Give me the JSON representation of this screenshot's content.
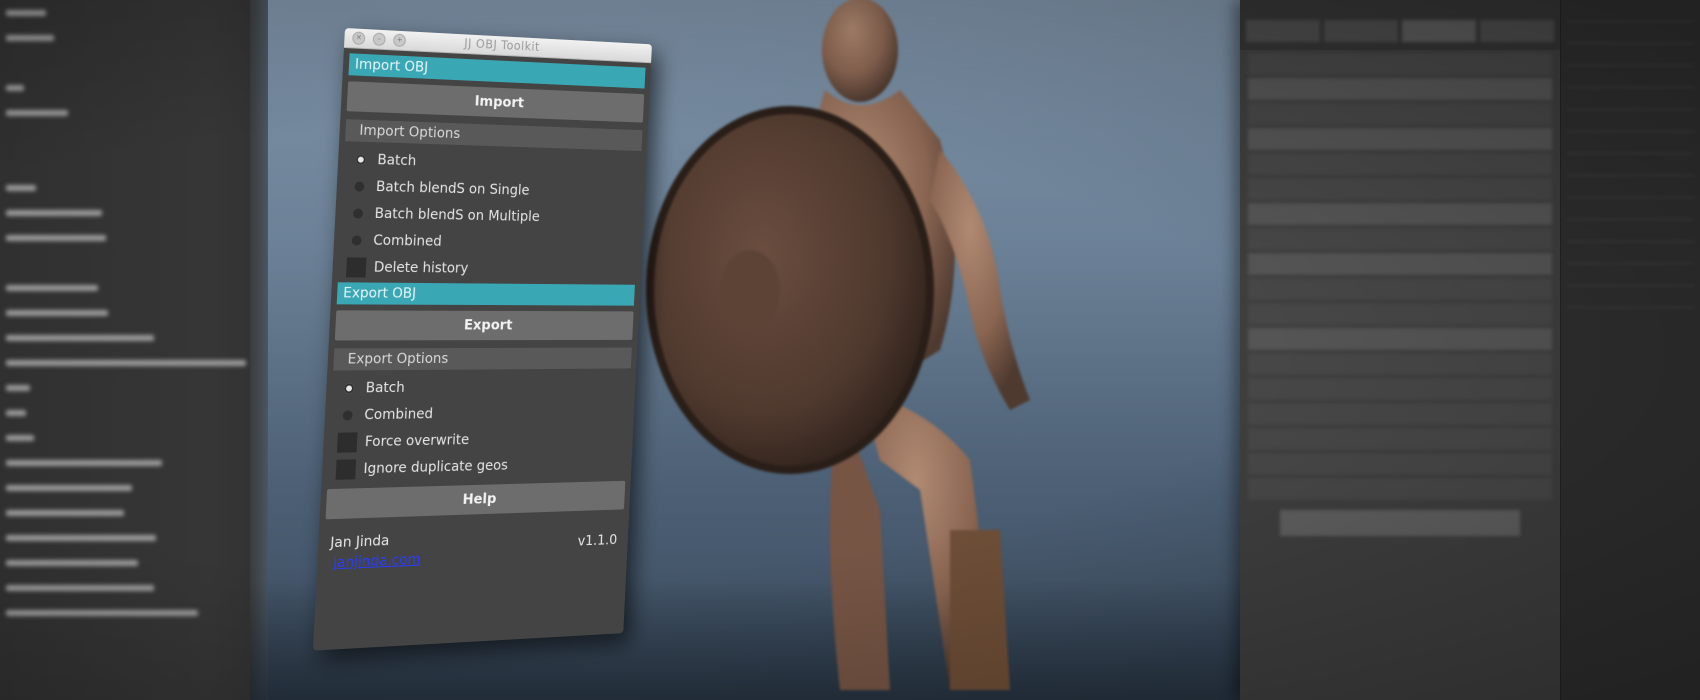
{
  "toolkit": {
    "title": "JJ OBJ Toolkit",
    "titlebar_icons": [
      "close-icon",
      "minimize-icon",
      "zoom-icon"
    ],
    "accent_color": "#3aa7b4",
    "import_section": {
      "header": "Import OBJ",
      "button_label": "Import",
      "options_header": "Import Options",
      "options": [
        {
          "label": "Batch",
          "selected": true
        },
        {
          "label": "Batch blendS on Single",
          "selected": false
        },
        {
          "label": "Batch blendS on Multiple",
          "selected": false
        },
        {
          "label": "Combined",
          "selected": false
        }
      ],
      "checkbox_label": "Delete history"
    },
    "export_section": {
      "header": "Export OBJ",
      "button_label": "Export",
      "options_header": "Export Options",
      "options": [
        {
          "label": "Batch",
          "selected": true
        },
        {
          "label": "Combined",
          "selected": false
        }
      ],
      "checkboxes": [
        "Force overwrite",
        "Ignore duplicate geos"
      ]
    },
    "help_label": "Help",
    "footer": {
      "author": "Jan Jinda",
      "link": "janjinda.com",
      "version": "v1.1.0"
    }
  }
}
